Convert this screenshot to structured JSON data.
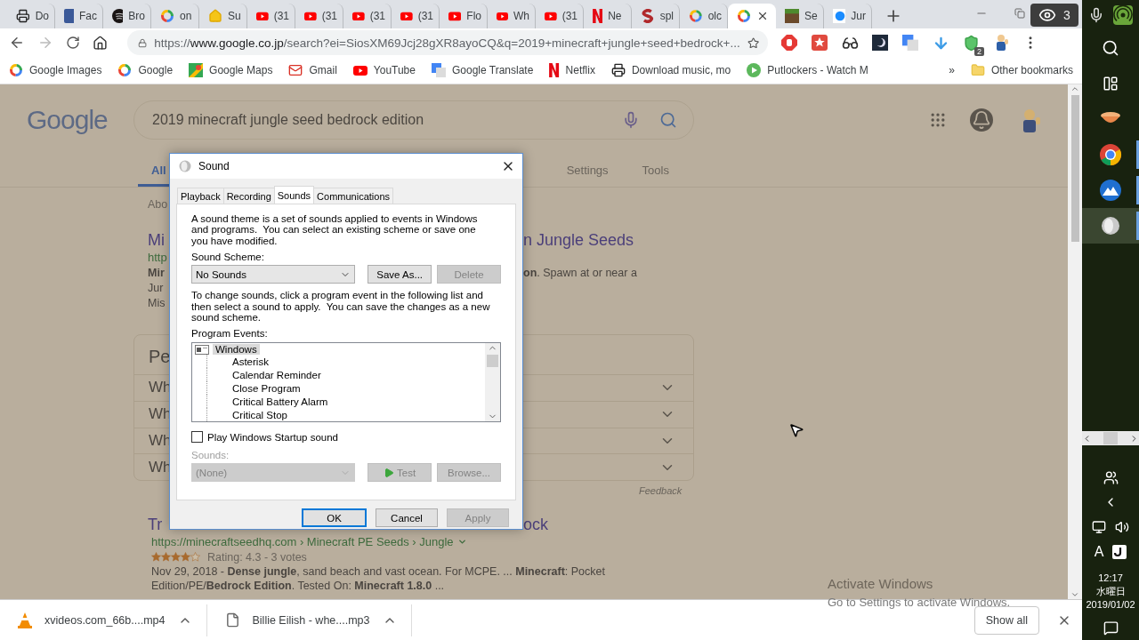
{
  "browser_tabs": [
    {
      "kind": "printer",
      "title": "Do",
      "selected": false
    },
    {
      "kind": "square",
      "title": "Fac",
      "selected": false
    },
    {
      "kind": "disc",
      "title": "Bro",
      "selected": false
    },
    {
      "kind": "ring",
      "title": "on",
      "selected": false
    },
    {
      "kind": "house",
      "title": "Su",
      "selected": false
    },
    {
      "kind": "play",
      "title": "(31",
      "selected": false
    },
    {
      "kind": "play",
      "title": "(31",
      "selected": false
    },
    {
      "kind": "play",
      "title": "(31",
      "selected": false
    },
    {
      "kind": "play",
      "title": "(31",
      "selected": false
    },
    {
      "kind": "play",
      "title": "Flo",
      "selected": false
    },
    {
      "kind": "play",
      "title": "Wh",
      "selected": false
    },
    {
      "kind": "play",
      "title": "(31",
      "selected": false
    },
    {
      "kind": "bars",
      "title": "Ne",
      "selected": false
    },
    {
      "kind": "swirl",
      "title": "spl",
      "selected": false
    },
    {
      "kind": "ring",
      "title": "olc",
      "selected": false
    },
    {
      "kind": "ring",
      "selected": true
    },
    {
      "kind": "block",
      "title": "Se",
      "selected": false
    },
    {
      "kind": "dot",
      "title": "Jur",
      "selected": false
    }
  ],
  "recorder_badge": {
    "count": "3"
  },
  "address_bar": {
    "scheme": "https://",
    "host": "www.google.co.jp",
    "path": "/search?ei=SiosXM69Jcj28gXR8ayoCQ&q=2019+minecraft+jungle+seed+bedrock+..."
  },
  "extensions": [
    {
      "kind": "octagon"
    },
    {
      "kind": "star"
    },
    {
      "kind": "glasses"
    },
    {
      "kind": "moon"
    },
    {
      "kind": "translate"
    },
    {
      "kind": "download"
    },
    {
      "kind": "shield",
      "badge": "2"
    },
    {
      "kind": "figure"
    }
  ],
  "bookmarks": [
    {
      "kind": "ring",
      "label": "Google Images"
    },
    {
      "kind": "ring",
      "label": "Google"
    },
    {
      "kind": "map",
      "label": "Google Maps"
    },
    {
      "kind": "mail",
      "label": "Gmail"
    },
    {
      "kind": "play",
      "label": "YouTube"
    },
    {
      "kind": "translate",
      "label": "Google Translate"
    },
    {
      "kind": "bars",
      "label": "Netflix"
    },
    {
      "kind": "printer",
      "label": "Download music, mo"
    },
    {
      "kind": "circle-play",
      "label": "Putlockers - Watch M"
    }
  ],
  "bookmarks_overflow": "»",
  "other_bookmarks": "Other bookmarks",
  "search_page": {
    "logo": "Google",
    "query": "2019 minecraft jungle seed bedrock edition",
    "nav_tabs": [
      {
        "label": "All",
        "selected": true
      }
    ],
    "nav_tools": [
      "Settings",
      "Tools"
    ],
    "stats": "Abo",
    "result_1": {
      "title_left": "Mi",
      "title_right": "n Jungle Seeds",
      "lines": [
        {
          "left": "http",
          "kind": "url"
        },
        {
          "left": "Mir",
          "right": "**on**. Spawn at or near a",
          "kind": "snippet"
        },
        {
          "left": "Jur",
          "kind": "snippet"
        },
        {
          "left": "Mis",
          "kind": "snippet"
        }
      ]
    },
    "people_also_ask": {
      "heading": "Pe",
      "questions": [
        "Wh",
        "Wh",
        "Wh",
        "Wh"
      ],
      "feedback": "Feedback"
    },
    "result_2": {
      "title_left": "Tr",
      "title_right": "ock",
      "url": "https://minecraftseedhq.com › Minecraft PE Seeds › Jungle",
      "stars": 4,
      "rating": "Rating: 4.3 - 3 votes",
      "snippet": "Nov 29, 2018 - **Dense jungle**, sand beach and vast ocean. For MCPE. ... **Minecraft**: Pocket Edition/PE/**Bedrock Edition**. Tested On: **Minecraft 1.8.0** ..."
    }
  },
  "dialog": {
    "title": "Sound",
    "tabs": [
      {
        "label": "Playback",
        "selected": false
      },
      {
        "label": "Recording",
        "selected": false
      },
      {
        "label": "Sounds",
        "selected": true
      },
      {
        "label": "Communications",
        "selected": false
      }
    ],
    "intro": "A sound theme is a set of sounds applied to events in Windows and programs.  You can select an existing scheme or save one you have modified.",
    "scheme_label": "Sound Scheme:",
    "scheme_value": "No Sounds",
    "scheme_buttons": [
      {
        "label": "Save As...",
        "disabled": false
      },
      {
        "label": "Delete",
        "disabled": true
      }
    ],
    "change_text": "To change sounds, click a program event in the following list and then select a sound to apply.  You can save the changes as a new sound scheme.",
    "events_label": "Program Events:",
    "events": [
      {
        "label": "Windows",
        "selected": true,
        "children": [
          {
            "label": "Asterisk",
            "selected": false
          },
          {
            "label": "Calendar Reminder",
            "selected": false
          },
          {
            "label": "Close Program",
            "selected": false
          },
          {
            "label": "Critical Battery Alarm",
            "selected": false
          },
          {
            "label": "Critical Stop",
            "selected": false
          }
        ]
      }
    ],
    "startup": {
      "label": "Play Windows Startup sound",
      "checked": false
    },
    "sounds_label": {
      "text": "Sounds:",
      "disabled": true
    },
    "sound_value": {
      "value": "(None)",
      "disabled": true
    },
    "sound_buttons": [
      {
        "label": "Test",
        "kind": "play",
        "disabled": true
      },
      {
        "label": "Browse...",
        "kind": "plain",
        "disabled": true
      }
    ],
    "footer_buttons": [
      {
        "label": "OK",
        "default": true,
        "disabled": false
      },
      {
        "label": "Cancel",
        "default": false,
        "disabled": false
      },
      {
        "label": "Apply",
        "default": false,
        "disabled": true
      }
    ]
  },
  "downloads": [
    {
      "kind": "cone",
      "name": "xvideos.com_66b....mp4"
    },
    {
      "kind": "file",
      "name": "Billie Eilish - whe....mp3"
    }
  ],
  "show_all": "Show all",
  "activation": [
    "Activate Windows",
    "Go to Settings to activate Windows."
  ],
  "taskbar": {
    "apps": [
      {
        "kind": "bowl",
        "selected": false,
        "running": false
      },
      {
        "kind": "ring",
        "selected": false,
        "running": true
      },
      {
        "kind": "mountain",
        "selected": false,
        "running": true
      },
      {
        "kind": "speaker",
        "selected": true,
        "running": true
      }
    ],
    "ime": "A",
    "time": "12:17",
    "day": "水曜日",
    "date": "2019/01/02"
  }
}
